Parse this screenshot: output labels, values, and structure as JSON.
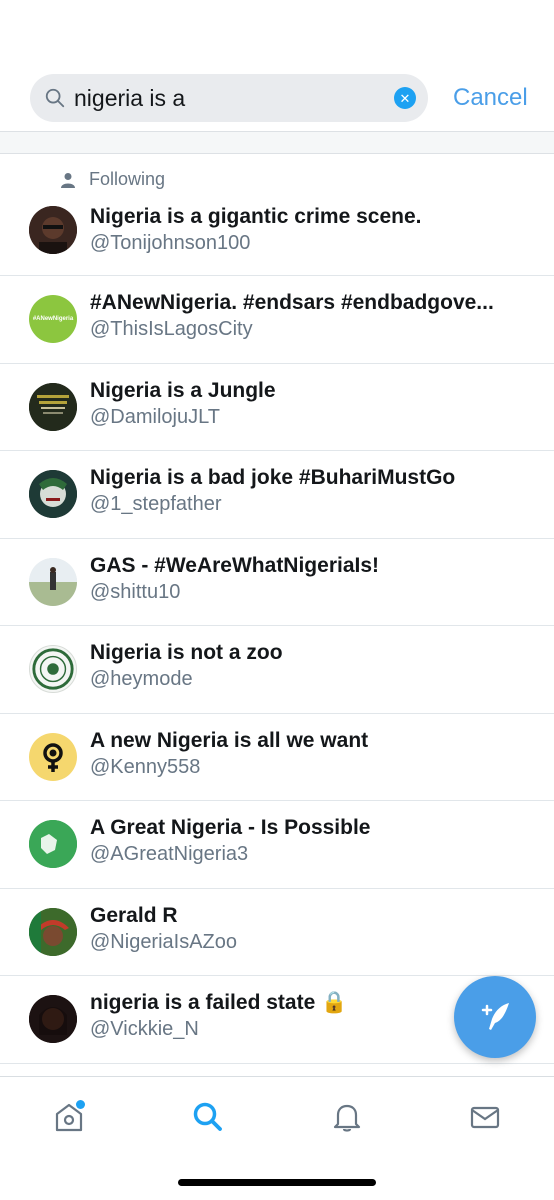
{
  "search": {
    "query": "nigeria is a",
    "cancel_label": "Cancel"
  },
  "section": {
    "following_label": "Following"
  },
  "results": [
    {
      "title": "Nigeria is a gigantic crime scene.",
      "handle": "@Tonijohnson100"
    },
    {
      "title": "#ANewNigeria. #endsars #endbadgove...",
      "handle": "@ThisIsLagosCity",
      "avatar_text": "#ANewNigeria"
    },
    {
      "title": "Nigeria is a Jungle",
      "handle": "@DamilojuJLT"
    },
    {
      "title": "Nigeria is a bad joke #BuhariMustGo",
      "handle": "@1_stepfather"
    },
    {
      "title": "GAS - #WeAreWhatNigeriaIs!",
      "handle": "@shittu10"
    },
    {
      "title": "Nigeria is not a zoo",
      "handle": "@heymode"
    },
    {
      "title": "A new Nigeria is all we want",
      "handle": "@Kenny558"
    },
    {
      "title": "A Great Nigeria - Is Possible",
      "handle": "@AGreatNigeria3"
    },
    {
      "title": "Gerald R",
      "handle": "@NigeriaIsAZoo"
    },
    {
      "title": "nigeria is a failed state 🔒",
      "handle": "@Vickkie_N"
    }
  ],
  "tabs": [
    {
      "name": "home",
      "icon": "home-icon",
      "has_badge": true
    },
    {
      "name": "search",
      "icon": "search-icon",
      "active": true
    },
    {
      "name": "notifications",
      "icon": "bell-icon"
    },
    {
      "name": "messages",
      "icon": "mail-icon"
    }
  ],
  "colors": {
    "accent": "#1da1f2",
    "cancel": "#4a9ee8",
    "secondary_text": "#687684"
  }
}
